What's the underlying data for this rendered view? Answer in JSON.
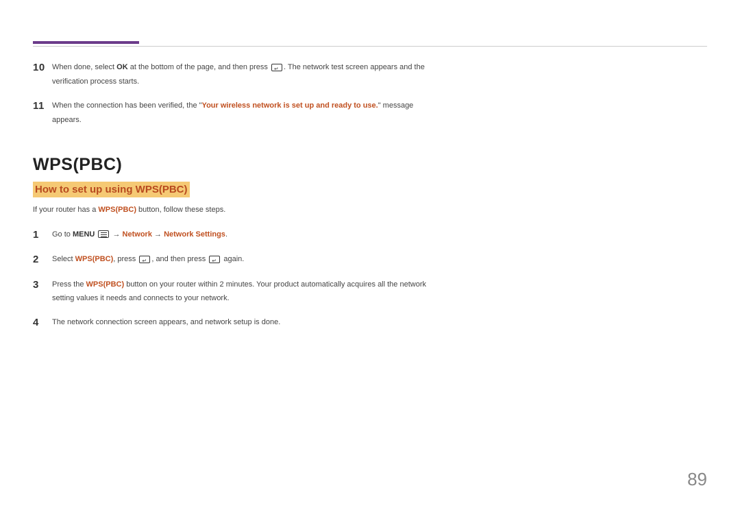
{
  "steps_top": [
    {
      "number": "10",
      "parts": [
        {
          "text": "When done, select ",
          "style": ""
        },
        {
          "text": "OK",
          "style": "bold-dark"
        },
        {
          "text": " at the bottom of the page, and then press ",
          "style": ""
        },
        {
          "icon": "enter"
        },
        {
          "text": ". The network test screen appears and the verification process starts.",
          "style": ""
        }
      ]
    },
    {
      "number": "11",
      "parts": [
        {
          "text": "When the connection has been verified, the \"",
          "style": ""
        },
        {
          "text": "Your wireless network is set up and ready to use.",
          "style": "bold-orange"
        },
        {
          "text": "\" message appears.",
          "style": ""
        }
      ]
    }
  ],
  "section": {
    "title": "WPS(PBC)",
    "subtitle": "How to set up using WPS(PBC)",
    "intro_prefix": "If your router has a ",
    "intro_bold": "WPS(PBC)",
    "intro_suffix": " button, follow these steps."
  },
  "steps_bottom": [
    {
      "number": "1",
      "parts": [
        {
          "text": "Go to ",
          "style": ""
        },
        {
          "text": "MENU",
          "style": "bold-dark"
        },
        {
          "text": " ",
          "style": ""
        },
        {
          "icon": "menu"
        },
        {
          "text": " → ",
          "style": ""
        },
        {
          "text": "Network",
          "style": "bold-orange"
        },
        {
          "text": " → ",
          "style": ""
        },
        {
          "text": "Network Settings",
          "style": "bold-orange"
        },
        {
          "text": ".",
          "style": ""
        }
      ]
    },
    {
      "number": "2",
      "parts": [
        {
          "text": "Select ",
          "style": ""
        },
        {
          "text": "WPS(PBC)",
          "style": "bold-orange"
        },
        {
          "text": ", press ",
          "style": ""
        },
        {
          "icon": "enter"
        },
        {
          "text": ", and then press ",
          "style": ""
        },
        {
          "icon": "enter"
        },
        {
          "text": " again.",
          "style": ""
        }
      ]
    },
    {
      "number": "3",
      "parts": [
        {
          "text": "Press the ",
          "style": ""
        },
        {
          "text": "WPS(PBC)",
          "style": "bold-orange"
        },
        {
          "text": " button on your router within 2 minutes. Your product automatically acquires all the network setting values it needs and connects to your network.",
          "style": ""
        }
      ]
    },
    {
      "number": "4",
      "parts": [
        {
          "text": "The network connection screen appears, and network setup is done.",
          "style": ""
        }
      ]
    }
  ],
  "page_number": "89"
}
